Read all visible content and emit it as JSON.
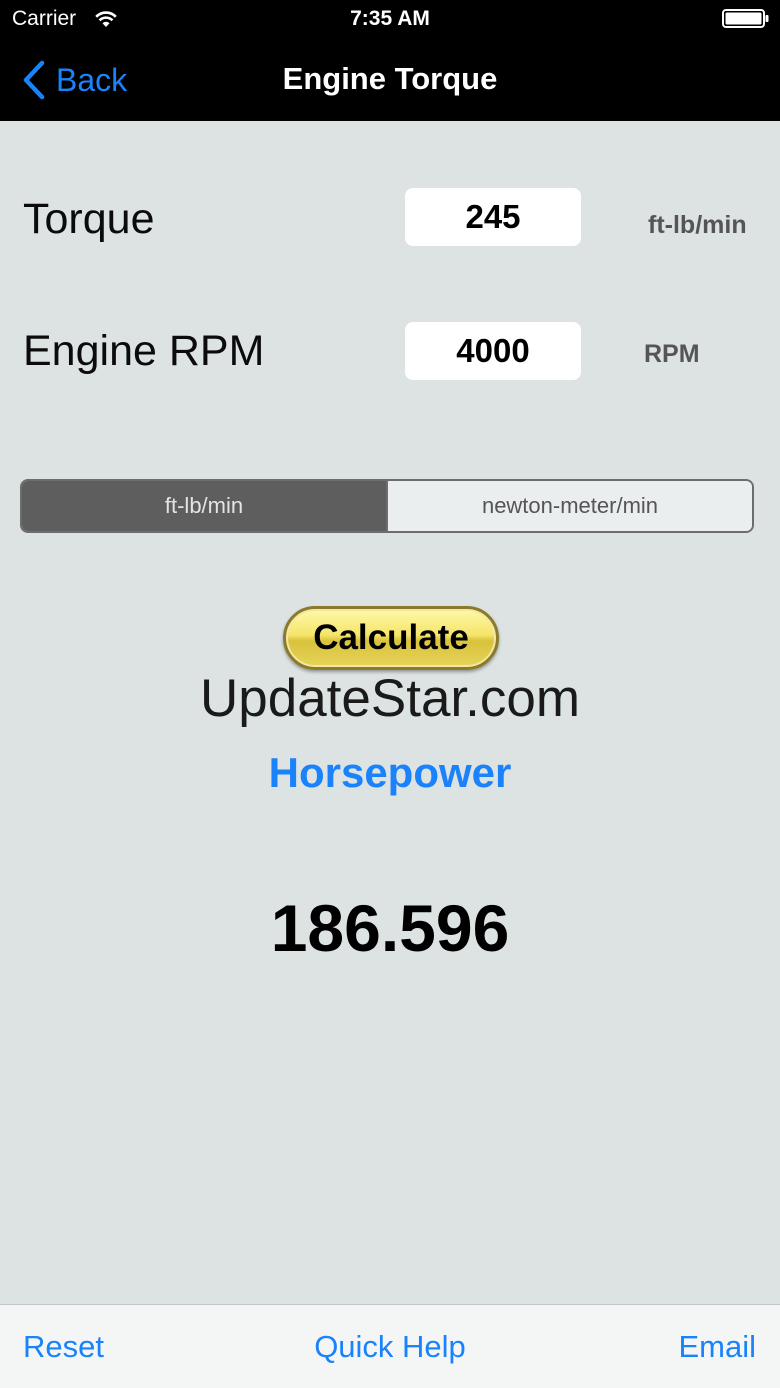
{
  "status_bar": {
    "carrier": "Carrier",
    "time": "7:35 AM"
  },
  "nav": {
    "back_label": "Back",
    "title": "Engine Torque"
  },
  "form": {
    "torque": {
      "label": "Torque",
      "value": "245",
      "unit": "ft-lb/min"
    },
    "rpm": {
      "label": "Engine RPM",
      "value": "4000",
      "unit": "RPM"
    }
  },
  "unit_selector": {
    "options": [
      "ft-lb/min",
      "newton-meter/min"
    ],
    "selected": "ft-lb/min"
  },
  "calculate_label": "Calculate",
  "watermark": "UpdateStar.com",
  "result": {
    "label": "Horsepower",
    "value": "186.596"
  },
  "toolbar": {
    "reset_label": "Reset",
    "help_label": "Quick Help",
    "email_label": "Email"
  },
  "colors": {
    "accent": "#1a82fb",
    "background": "#dde3e3",
    "nav_bar": "#000000"
  },
  "icons": [
    "wifi-icon",
    "battery-icon",
    "chevron-left-icon"
  ]
}
